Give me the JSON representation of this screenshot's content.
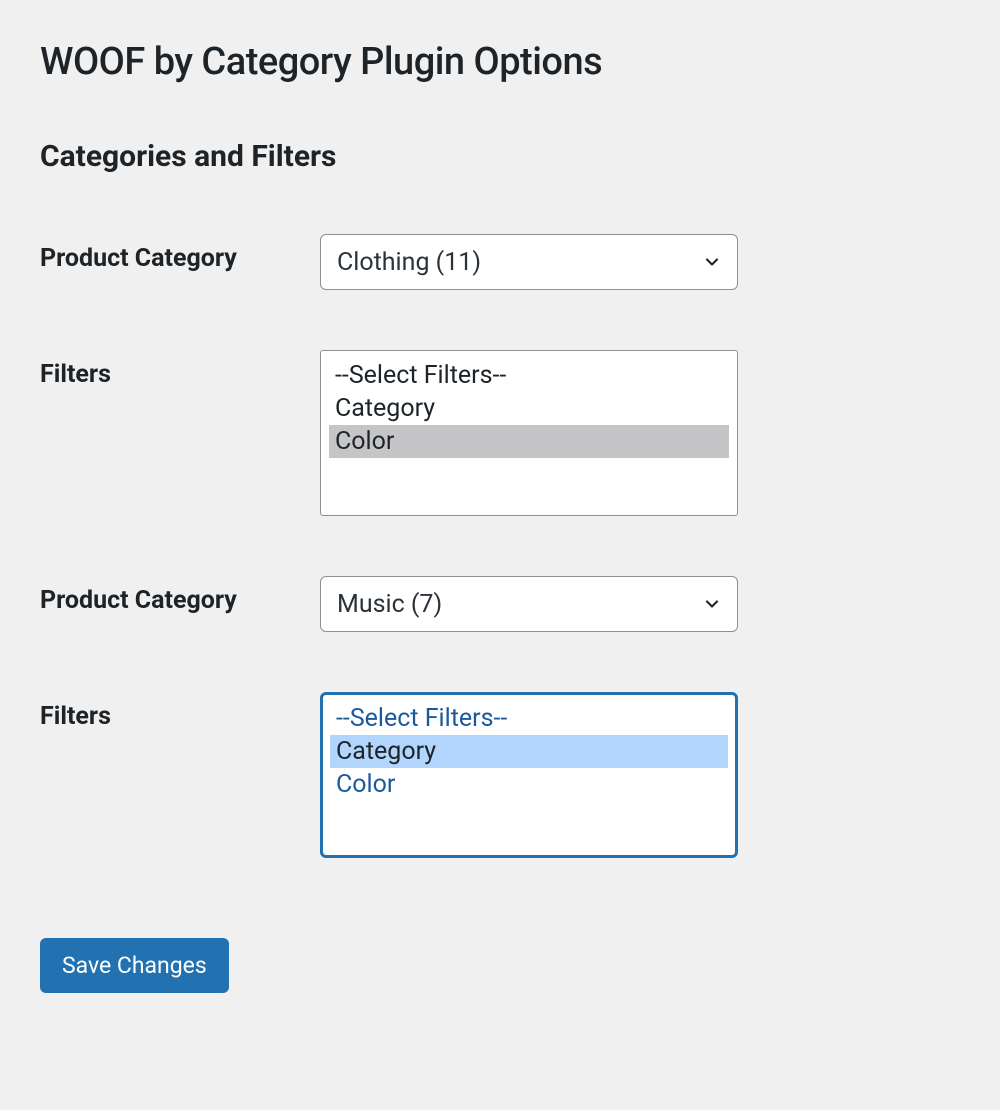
{
  "page": {
    "title": "WOOF by Category Plugin Options",
    "section_heading": "Categories and Filters"
  },
  "groups": [
    {
      "category_label": "Product Category",
      "category_value": "Clothing (11)",
      "filters_label": "Filters",
      "filters_placeholder": "--Select Filters--",
      "filters_options": [
        "Category",
        "Color"
      ],
      "filters_selected_index": 1,
      "focused": false
    },
    {
      "category_label": "Product Category",
      "category_value": "Music (7)",
      "filters_label": "Filters",
      "filters_placeholder": "--Select Filters--",
      "filters_options": [
        "Category",
        "Color"
      ],
      "filters_selected_index": 0,
      "focused": true
    }
  ],
  "actions": {
    "save_label": "Save Changes"
  }
}
